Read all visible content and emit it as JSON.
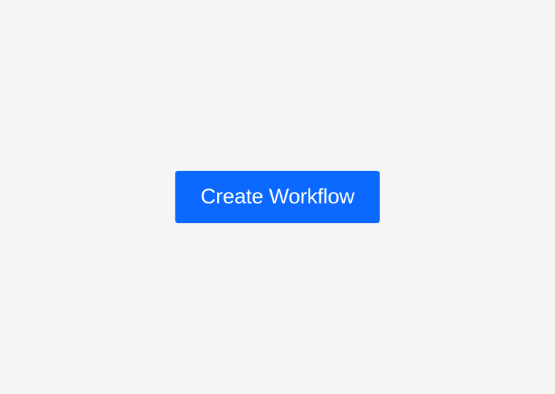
{
  "button": {
    "label": "Create Workflow"
  }
}
